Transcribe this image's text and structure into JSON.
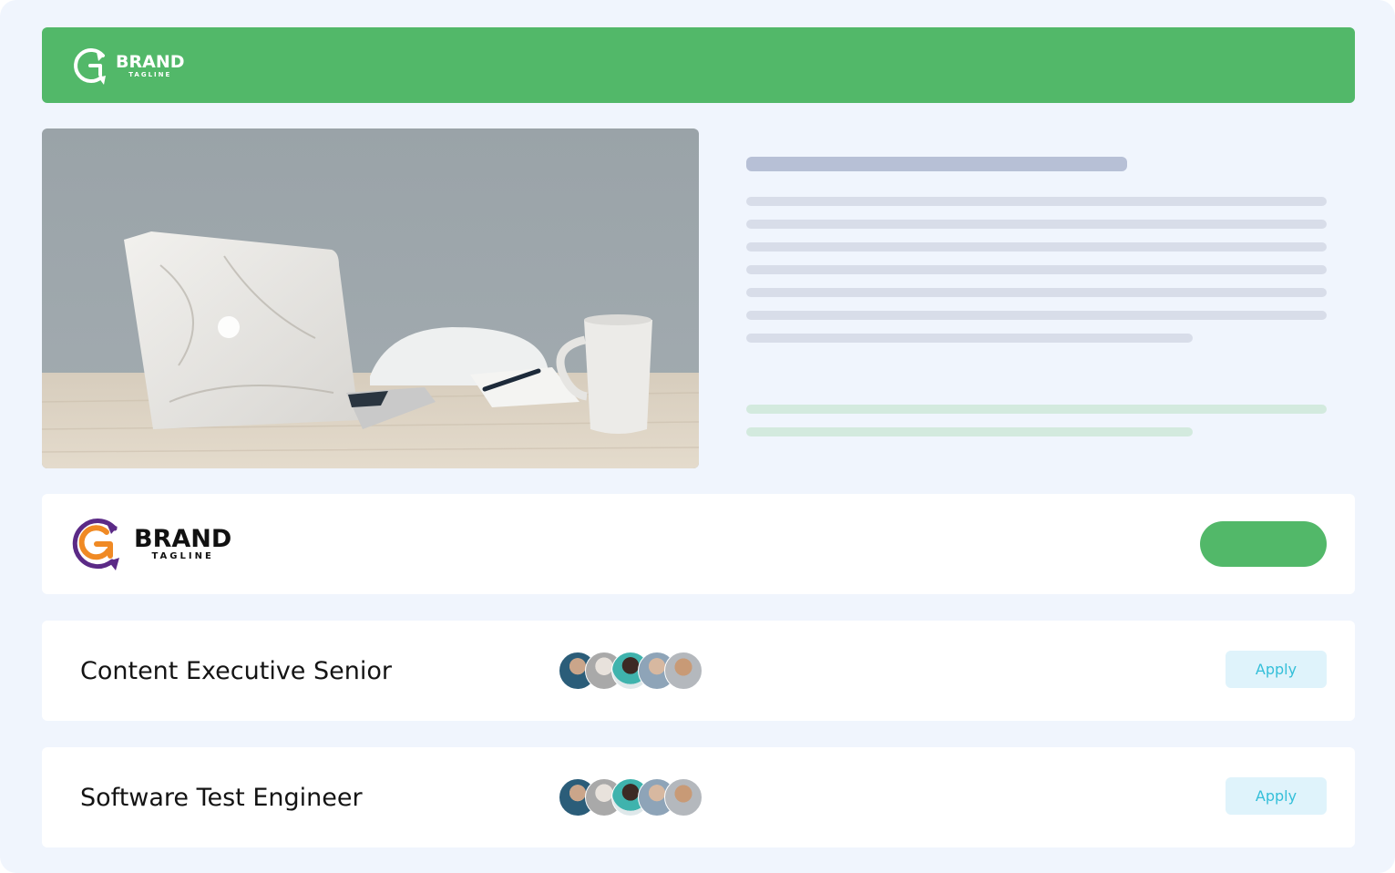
{
  "header": {
    "logo": {
      "brand": "BRAND",
      "tagline": "TAGLINE"
    }
  },
  "hero": {
    "image": "laptop-on-desk-photo"
  },
  "company": {
    "logo": {
      "brand": "BRAND",
      "tagline": "TAGLINE"
    },
    "cta_label": ""
  },
  "jobs": [
    {
      "title": "Content Executive Senior",
      "apply_label": "Apply"
    },
    {
      "title": "Software Test Engineer",
      "apply_label": "Apply"
    }
  ],
  "colors": {
    "accent_green": "#52b869",
    "apply_bg": "#dff3fb",
    "apply_text": "#34bfd9",
    "page_bg": "#f0f5fd",
    "skeleton_heading": "#b7c0d6",
    "skeleton_line": "#d8dde9",
    "skeleton_green": "#d3eade"
  }
}
